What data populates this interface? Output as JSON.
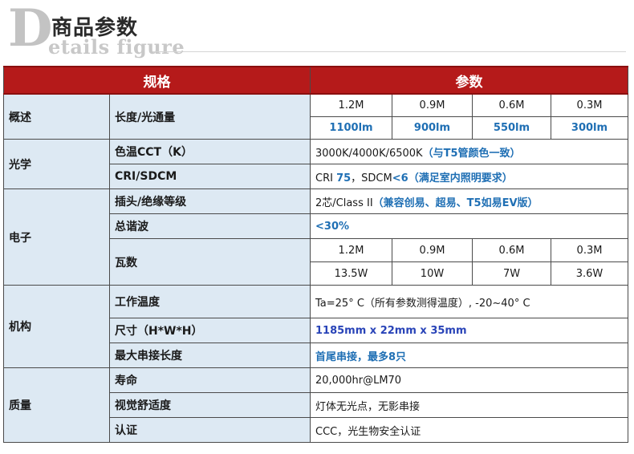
{
  "header": {
    "letter": "D",
    "title_cn": "商品参数",
    "title_en": "etails figure"
  },
  "table": {
    "col_spec": "规格",
    "col_param": "参数",
    "sections": {
      "overview": "概述",
      "optics": "光学",
      "electronics": "电子",
      "mechanism": "机构",
      "quality": "质量"
    },
    "labels": {
      "length_flux": "长度/光通量",
      "cct": "色温CCT（K）",
      "cri": "CRI/SDCM",
      "plug": "插头/绝缘等级",
      "thd": "总谐波",
      "watt": "瓦数",
      "temp": "工作温度",
      "size": "尺寸（H*W*H）",
      "max_series": "最大串接长度",
      "life": "寿命",
      "comfort": "视觉舒适度",
      "cert": "认证"
    },
    "lengths": [
      "1.2M",
      "0.9M",
      "0.6M",
      "0.3M"
    ],
    "flux": [
      "1100lm",
      "900lm",
      "550lm",
      "300lm"
    ],
    "cct_value": "3000K/4000K/6500K",
    "cct_note": "（与T5管颜色一致）",
    "cri_prefix": "CRI ",
    "cri_value": "75",
    "cri_mid": "，SDCM",
    "sdcm_value": "<6",
    "cri_note": "（满足室内照明要求）",
    "plug_value": "2芯/Class II",
    "plug_note": "（兼容创易、超易、T5如易EV版）",
    "thd_value": "<30%",
    "watt_lengths": [
      "1.2M",
      "0.9M",
      "0.6M",
      "0.3M"
    ],
    "watts": [
      "13.5W",
      "10W",
      "7W",
      "3.6W"
    ],
    "temp_value": "Ta=25° C（所有参数测得温度）, -20~40° C",
    "size_value": "1185mm x 22mm x 35mm",
    "max_series_value": "首尾串接，最多8只",
    "life_value": "20,000hr@LM70",
    "comfort_value": "灯体无光点，无影串接",
    "cert_value": "CCC，光生物安全认证"
  }
}
